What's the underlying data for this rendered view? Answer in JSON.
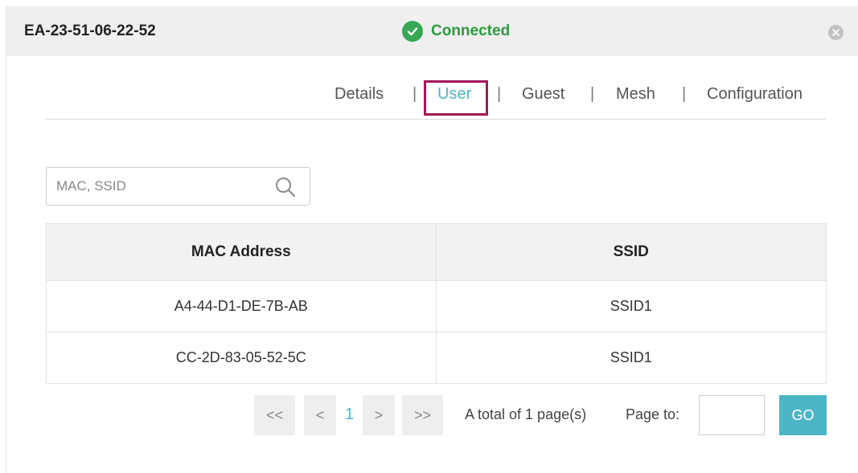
{
  "header": {
    "device_name": "EA-23-51-06-22-52",
    "status": "Connected",
    "status_color": "#34a853"
  },
  "tabs": [
    {
      "label": "Details",
      "active": false
    },
    {
      "label": "User",
      "active": true
    },
    {
      "label": "Guest",
      "active": false
    },
    {
      "label": "Mesh",
      "active": false
    },
    {
      "label": "Configuration",
      "active": false
    }
  ],
  "separator": "|",
  "search": {
    "placeholder": "MAC, SSID",
    "value": "",
    "icon": "search-icon"
  },
  "table": {
    "columns": [
      "MAC Address",
      "SSID"
    ],
    "rows": [
      [
        "A4-44-D1-DE-7B-AB",
        "SSID1"
      ],
      [
        "CC-2D-83-05-52-5C",
        "SSID1"
      ]
    ]
  },
  "pagination": {
    "first": "<<",
    "prev": "<",
    "current_page": "1",
    "next": ">",
    "last": ">>",
    "total_text": "A total of 1 page(s)",
    "page_to_label": "Page to:",
    "page_to_value": "",
    "go_label": "GO"
  },
  "colors": {
    "accent": "#4db6c6",
    "highlight_box": "#a4185a"
  }
}
